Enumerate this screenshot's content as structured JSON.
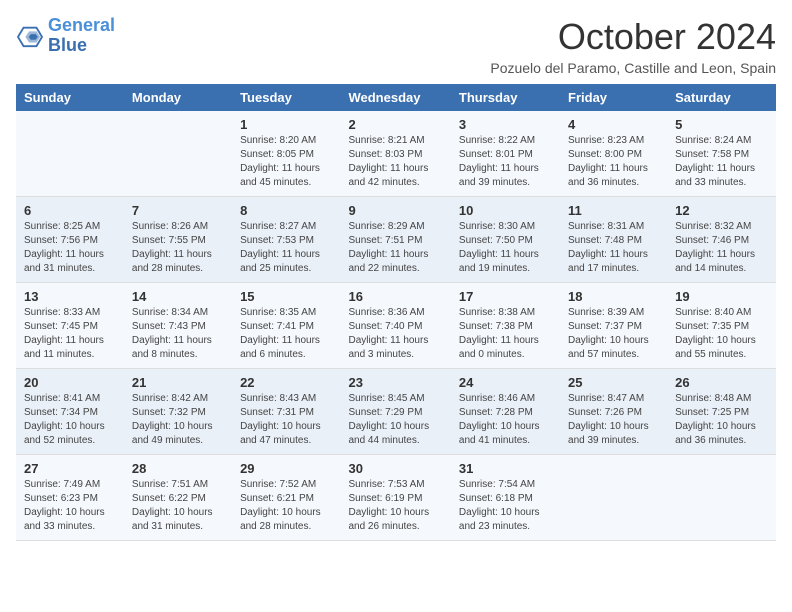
{
  "header": {
    "logo_line1": "General",
    "logo_line2": "Blue",
    "month_title": "October 2024",
    "location": "Pozuelo del Paramo, Castille and Leon, Spain"
  },
  "days_of_week": [
    "Sunday",
    "Monday",
    "Tuesday",
    "Wednesday",
    "Thursday",
    "Friday",
    "Saturday"
  ],
  "weeks": [
    [
      {
        "day": "",
        "detail": ""
      },
      {
        "day": "",
        "detail": ""
      },
      {
        "day": "1",
        "detail": "Sunrise: 8:20 AM\nSunset: 8:05 PM\nDaylight: 11 hours and 45 minutes."
      },
      {
        "day": "2",
        "detail": "Sunrise: 8:21 AM\nSunset: 8:03 PM\nDaylight: 11 hours and 42 minutes."
      },
      {
        "day": "3",
        "detail": "Sunrise: 8:22 AM\nSunset: 8:01 PM\nDaylight: 11 hours and 39 minutes."
      },
      {
        "day": "4",
        "detail": "Sunrise: 8:23 AM\nSunset: 8:00 PM\nDaylight: 11 hours and 36 minutes."
      },
      {
        "day": "5",
        "detail": "Sunrise: 8:24 AM\nSunset: 7:58 PM\nDaylight: 11 hours and 33 minutes."
      }
    ],
    [
      {
        "day": "6",
        "detail": "Sunrise: 8:25 AM\nSunset: 7:56 PM\nDaylight: 11 hours and 31 minutes."
      },
      {
        "day": "7",
        "detail": "Sunrise: 8:26 AM\nSunset: 7:55 PM\nDaylight: 11 hours and 28 minutes."
      },
      {
        "day": "8",
        "detail": "Sunrise: 8:27 AM\nSunset: 7:53 PM\nDaylight: 11 hours and 25 minutes."
      },
      {
        "day": "9",
        "detail": "Sunrise: 8:29 AM\nSunset: 7:51 PM\nDaylight: 11 hours and 22 minutes."
      },
      {
        "day": "10",
        "detail": "Sunrise: 8:30 AM\nSunset: 7:50 PM\nDaylight: 11 hours and 19 minutes."
      },
      {
        "day": "11",
        "detail": "Sunrise: 8:31 AM\nSunset: 7:48 PM\nDaylight: 11 hours and 17 minutes."
      },
      {
        "day": "12",
        "detail": "Sunrise: 8:32 AM\nSunset: 7:46 PM\nDaylight: 11 hours and 14 minutes."
      }
    ],
    [
      {
        "day": "13",
        "detail": "Sunrise: 8:33 AM\nSunset: 7:45 PM\nDaylight: 11 hours and 11 minutes."
      },
      {
        "day": "14",
        "detail": "Sunrise: 8:34 AM\nSunset: 7:43 PM\nDaylight: 11 hours and 8 minutes."
      },
      {
        "day": "15",
        "detail": "Sunrise: 8:35 AM\nSunset: 7:41 PM\nDaylight: 11 hours and 6 minutes."
      },
      {
        "day": "16",
        "detail": "Sunrise: 8:36 AM\nSunset: 7:40 PM\nDaylight: 11 hours and 3 minutes."
      },
      {
        "day": "17",
        "detail": "Sunrise: 8:38 AM\nSunset: 7:38 PM\nDaylight: 11 hours and 0 minutes."
      },
      {
        "day": "18",
        "detail": "Sunrise: 8:39 AM\nSunset: 7:37 PM\nDaylight: 10 hours and 57 minutes."
      },
      {
        "day": "19",
        "detail": "Sunrise: 8:40 AM\nSunset: 7:35 PM\nDaylight: 10 hours and 55 minutes."
      }
    ],
    [
      {
        "day": "20",
        "detail": "Sunrise: 8:41 AM\nSunset: 7:34 PM\nDaylight: 10 hours and 52 minutes."
      },
      {
        "day": "21",
        "detail": "Sunrise: 8:42 AM\nSunset: 7:32 PM\nDaylight: 10 hours and 49 minutes."
      },
      {
        "day": "22",
        "detail": "Sunrise: 8:43 AM\nSunset: 7:31 PM\nDaylight: 10 hours and 47 minutes."
      },
      {
        "day": "23",
        "detail": "Sunrise: 8:45 AM\nSunset: 7:29 PM\nDaylight: 10 hours and 44 minutes."
      },
      {
        "day": "24",
        "detail": "Sunrise: 8:46 AM\nSunset: 7:28 PM\nDaylight: 10 hours and 41 minutes."
      },
      {
        "day": "25",
        "detail": "Sunrise: 8:47 AM\nSunset: 7:26 PM\nDaylight: 10 hours and 39 minutes."
      },
      {
        "day": "26",
        "detail": "Sunrise: 8:48 AM\nSunset: 7:25 PM\nDaylight: 10 hours and 36 minutes."
      }
    ],
    [
      {
        "day": "27",
        "detail": "Sunrise: 7:49 AM\nSunset: 6:23 PM\nDaylight: 10 hours and 33 minutes."
      },
      {
        "day": "28",
        "detail": "Sunrise: 7:51 AM\nSunset: 6:22 PM\nDaylight: 10 hours and 31 minutes."
      },
      {
        "day": "29",
        "detail": "Sunrise: 7:52 AM\nSunset: 6:21 PM\nDaylight: 10 hours and 28 minutes."
      },
      {
        "day": "30",
        "detail": "Sunrise: 7:53 AM\nSunset: 6:19 PM\nDaylight: 10 hours and 26 minutes."
      },
      {
        "day": "31",
        "detail": "Sunrise: 7:54 AM\nSunset: 6:18 PM\nDaylight: 10 hours and 23 minutes."
      },
      {
        "day": "",
        "detail": ""
      },
      {
        "day": "",
        "detail": ""
      }
    ]
  ]
}
